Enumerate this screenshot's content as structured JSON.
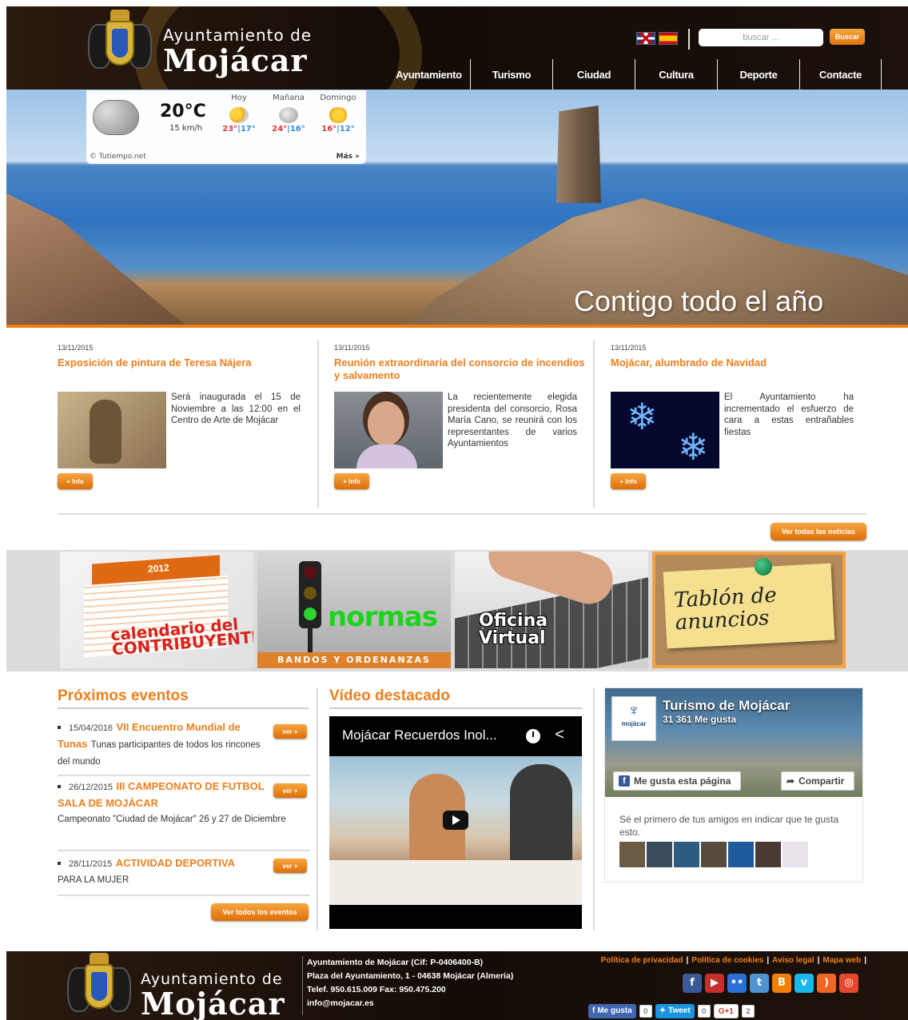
{
  "header": {
    "logo_small": "Ayuntamiento de",
    "logo_big": "Mojácar",
    "search_placeholder": "buscar ...",
    "search_button": "Buscar",
    "languages": [
      "English",
      "Español"
    ]
  },
  "nav": [
    "Ayuntamiento",
    "Turismo",
    "Ciudad",
    "Cultura",
    "Deporte",
    "Contacte"
  ],
  "hero": {
    "caption": "Contigo todo el año"
  },
  "weather": {
    "temp": "20°C",
    "wind": "15 km/h",
    "days": [
      {
        "label": "Hoy",
        "hi": "23°",
        "lo": "17°",
        "icon": "partly-cloudy-icon"
      },
      {
        "label": "Mañana",
        "hi": "24°",
        "lo": "16°",
        "icon": "cloudy-icon"
      },
      {
        "label": "Domingo",
        "hi": "16°",
        "lo": "12°",
        "icon": "sun-icon"
      }
    ],
    "sep": "|",
    "credit": "© Tutiempo.net",
    "more": "Más »"
  },
  "news": [
    {
      "date": "13/11/2015",
      "title": "Exposición de pintura de Teresa Nájera",
      "text": "Será inaugurada el 15 de Noviembre a las 12:00 en el Centro de Arte de Mojácar",
      "button": "+ Info"
    },
    {
      "date": "13/11/2015",
      "title": "Reunión extraordinaria del consorcio de incendios y salvamento",
      "text": "La recientemente elegida presidenta del consorcio, Rosa María Cano, se reunirá con los representantes de varios Ayuntamientos",
      "button": "+ Info"
    },
    {
      "date": "13/11/2015",
      "title": "Mojácar, alumbrado de Navidad",
      "text": "El Ayuntamiento ha incrementado el esfuerzo de cara a estas entrañables fiestas",
      "button": "+ Info"
    }
  ],
  "all_news_button": "Ver todas las noticias",
  "banners": {
    "calendario_year": "2012",
    "calendario_line1": "calendario del",
    "calendario_line2": "CONTRIBUYENTE",
    "normas_word": "normas",
    "normas_band": "BANDOS Y ORDENANZAS",
    "oficina_line1": "Oficina",
    "oficina_line2": "Virtual",
    "tablon_line1": "Tablón de",
    "tablon_line2": "anuncios"
  },
  "events": {
    "title": "Próximos eventos",
    "items": [
      {
        "date": "15/04/2016",
        "title": "VII Encuentro Mundial de Tunas",
        "desc": "Tunas participantes de todos los rincones del mundo",
        "button": "ver +"
      },
      {
        "date": "26/12/2015",
        "title": "III CAMPEONATO DE FUTBOL SALA DE MOJÁCAR",
        "desc": "Campeonato \"Ciudad de Mojácar\" 26 y 27 de Diciembre",
        "button": "ver +"
      },
      {
        "date": "28/11/2015",
        "title": "ACTIVIDAD DEPORTIVA",
        "desc": "PARA LA MUJER",
        "button": "ver +"
      }
    ],
    "all_button": "Ver todos los eventos"
  },
  "video": {
    "title": "Vídeo destacado",
    "video_title": "Mojácar Recuerdos Inol..."
  },
  "facebook": {
    "page_name": "Turismo de Mojácar",
    "likes": "31 361 Me gusta",
    "logo_text": "mojácar",
    "like_button": "Me gusta esta página",
    "share_button": "Compartir",
    "first_friend": "Sé el primero de tus amigos en indicar que te gusta esto."
  },
  "footer": {
    "logo_small": "Ayuntamiento de",
    "logo_big": "Mojácar",
    "address_1": "Ayuntamiento de Mojácar (Cif: P-0406400-B)",
    "address_2": "Plaza del Ayuntamiento, 1 - 04638 Mojácar (Almería)",
    "address_3": "Telef. 950.615.009 Fax: 950.475.200",
    "address_4": "info@mojacar.es",
    "legal_links": [
      "Política de privacidad",
      "Política de cookies",
      "Aviso legal",
      "Mapa web"
    ],
    "social": [
      "facebook-icon",
      "youtube-icon",
      "flickr-icon",
      "tuenti-icon",
      "blogger-icon",
      "vimeo-icon",
      "rss-icon",
      "other-icon"
    ],
    "share_like": "Me gusta",
    "share_like_count": "0",
    "share_tweet": "Tweet",
    "share_tweet_count": "0",
    "share_g": "G+1",
    "share_g_count": "2"
  },
  "colors": {
    "accent": "#f07e1c",
    "header_bg": "#1a100a",
    "facebook": "#3b5998"
  }
}
